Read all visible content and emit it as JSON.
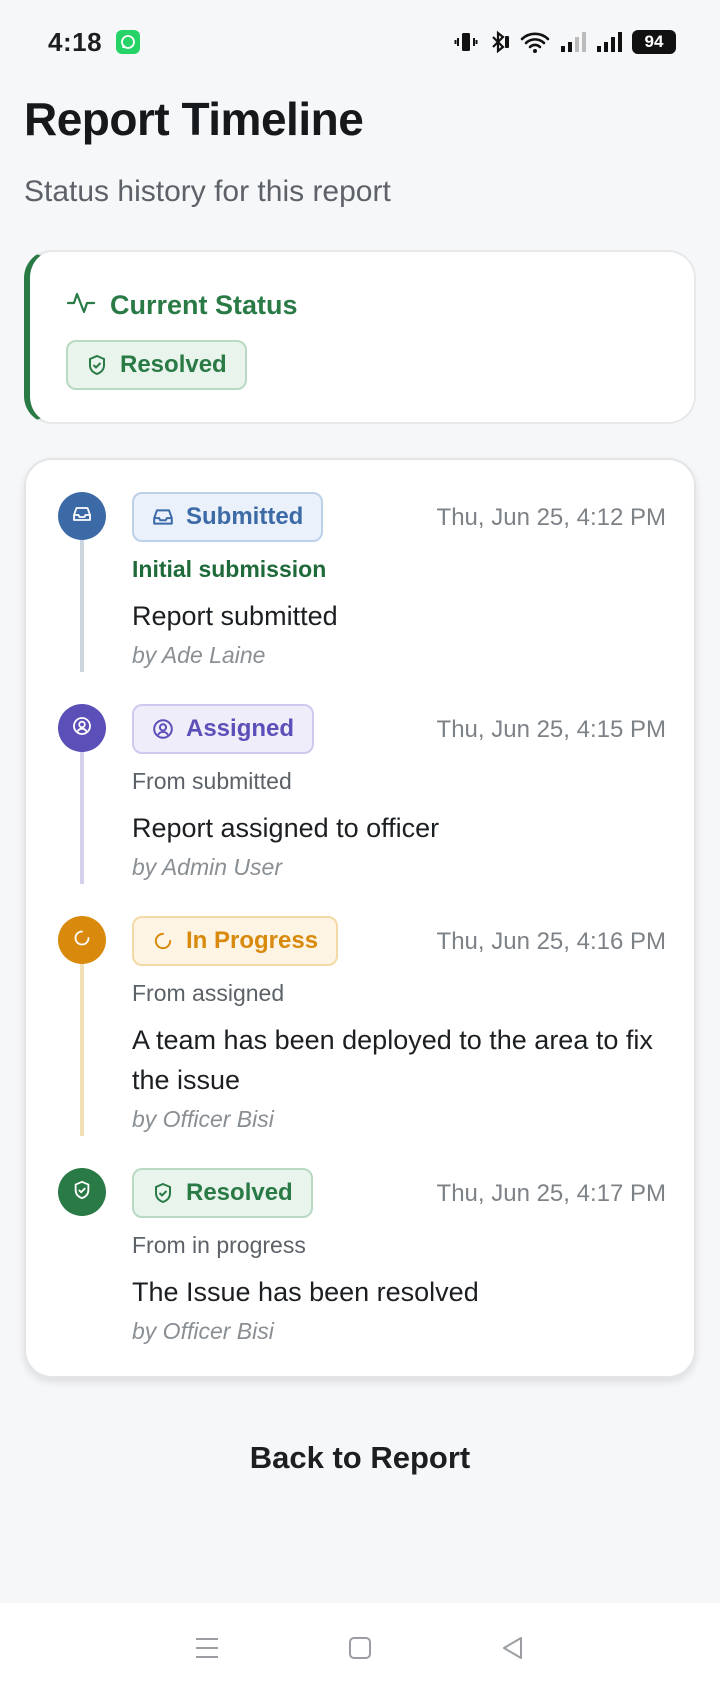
{
  "status_bar": {
    "time": "4:18",
    "battery": "94",
    "icons": [
      "whatsapp-icon",
      "vibrate-icon",
      "bluetooth-icon",
      "wifi-icon",
      "signal-icon",
      "signal-icon"
    ]
  },
  "header": {
    "title": "Report Timeline",
    "subtitle": "Status history for this report"
  },
  "current_status": {
    "title": "Current Status",
    "icon": "activity-icon",
    "badge_label": "Resolved",
    "badge_icon": "shield-check-icon",
    "accent_color": "#2a7a46"
  },
  "timeline": [
    {
      "status": "Submitted",
      "icon": "inbox-icon",
      "color": "#3c6aa6",
      "timestamp": "Thu, Jun 25, 4:12 PM",
      "from": "Initial submission",
      "comment": "Report submitted",
      "by": "by Ade Laine"
    },
    {
      "status": "Assigned",
      "icon": "user-circle-icon",
      "color": "#5b4fb8",
      "timestamp": "Thu, Jun 25, 4:15 PM",
      "from": "From submitted",
      "comment": "Report assigned to officer",
      "by": "by Admin User"
    },
    {
      "status": "In Progress",
      "icon": "loader-icon",
      "color": "#d98a0d",
      "timestamp": "Thu, Jun 25, 4:16 PM",
      "from": "From assigned",
      "comment": "A team has been deployed to the area to fix the issue",
      "by": "by Officer Bisi"
    },
    {
      "status": "Resolved",
      "icon": "shield-check-icon",
      "color": "#2a7a46",
      "timestamp": "Thu, Jun 25, 4:17 PM",
      "from": "From in progress",
      "comment": "The Issue has been resolved",
      "by": "by Officer Bisi"
    }
  ],
  "back_label": "Back to Report",
  "nav_bar": {
    "icons": [
      "menu-icon",
      "home-square-icon",
      "back-triangle-icon"
    ]
  }
}
